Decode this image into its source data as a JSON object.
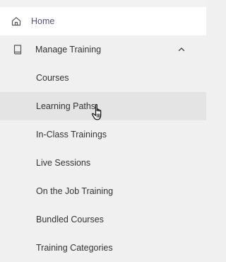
{
  "nav": {
    "home": {
      "label": "Home",
      "icon": "home-icon"
    },
    "manage_training": {
      "label": "Manage Training",
      "icon": "book-icon",
      "expanded": true,
      "toggle_icon": "chevron-up-icon",
      "children": [
        {
          "label": "Courses"
        },
        {
          "label": "Learning Paths",
          "hovered": true
        },
        {
          "label": "In-Class Trainings"
        },
        {
          "label": "Live Sessions"
        },
        {
          "label": "On the Job Training"
        },
        {
          "label": "Bundled Courses"
        },
        {
          "label": "Training Categories"
        }
      ]
    }
  },
  "colors": {
    "active_text": "#5b4e86",
    "menu_background": "#f0f0f0",
    "hover_background": "#e4e4e4",
    "home_background": "#ffffff"
  }
}
